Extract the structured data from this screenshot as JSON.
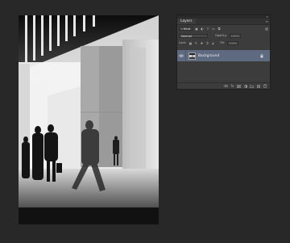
{
  "layers_panel": {
    "tab_label": "Layers",
    "filter_kind": "Kind",
    "blend_mode": "Normal",
    "opacity_label": "Opacity:",
    "opacity_value": "100%",
    "lock_label": "Lock:",
    "fill_label": "Fill:",
    "fill_value": "100%",
    "layers": [
      {
        "name": "Background",
        "visible": true,
        "locked": true,
        "selected": true
      }
    ]
  },
  "canvas": {
    "image": "black-and-white-photo-blurred-commuters-office-building"
  },
  "colors": {
    "workspace": "#282828",
    "panel": "#3c3c3c",
    "selected_layer": "#5d6a7f"
  }
}
